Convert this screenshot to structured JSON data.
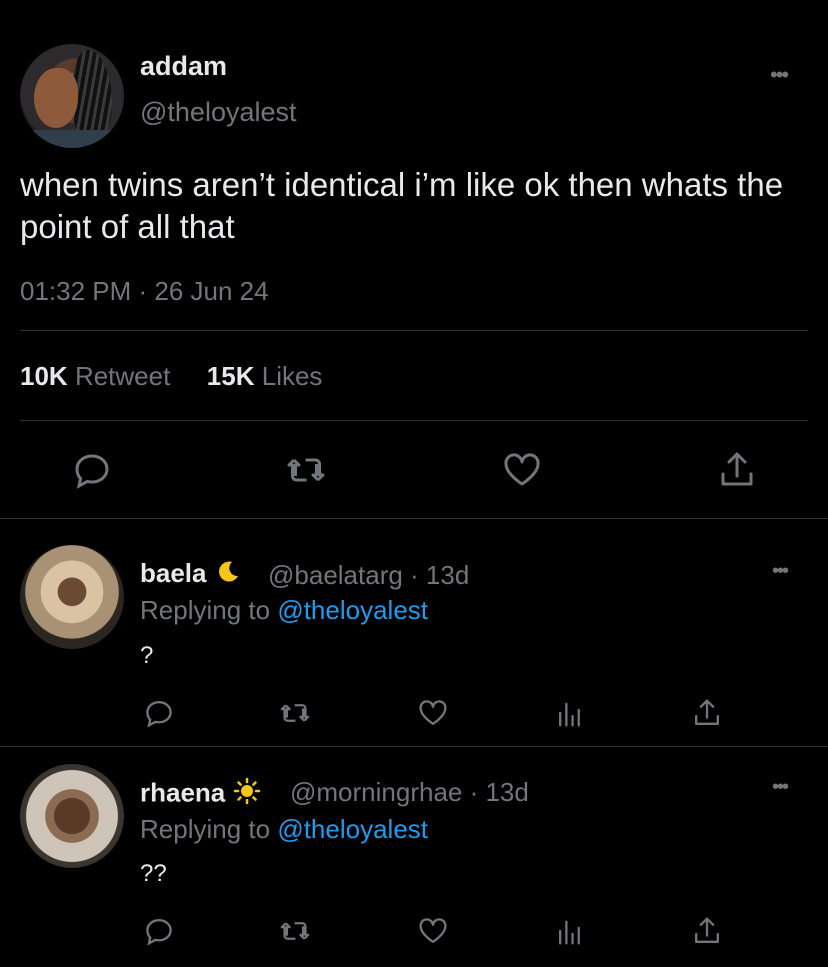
{
  "tweet": {
    "display_name": "addam",
    "handle": "@theloyalest",
    "text": "when twins aren’t identical i’m like ok then whats the point of all that",
    "timestamp": "01:32 PM · 26 Jun 24",
    "retweets_count": "10K",
    "retweets_label": "Retweet",
    "likes_count": "15K",
    "likes_label": "Likes",
    "more_icon": "ellipsis-icon"
  },
  "replies": [
    {
      "display_name": "baela",
      "emoji": "moon-icon",
      "meta": "@baelatarg · 13d",
      "replying_prefix": "Replying to",
      "replying_handle": "@theloyalest",
      "text": "?"
    },
    {
      "display_name": "rhaena",
      "emoji": "sun-icon",
      "meta": "@morningrhae · 13d",
      "replying_prefix": "Replying to",
      "replying_handle": "@theloyalest",
      "text": "??"
    }
  ],
  "colors": {
    "background": "#000000",
    "text": "#e7e9ea",
    "muted": "#71767b",
    "link": "#1d9bf0",
    "divider": "#2f3336"
  }
}
